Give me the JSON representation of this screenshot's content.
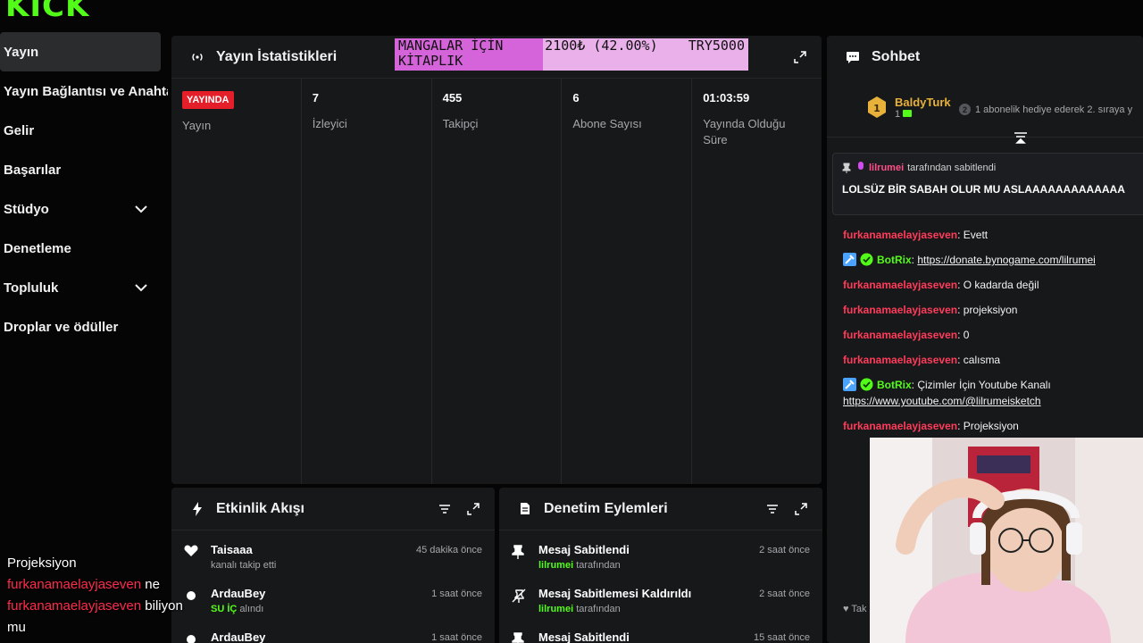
{
  "brand": {
    "logo_text": "KICK",
    "accent": "#53fc18"
  },
  "sidebar": {
    "items": [
      {
        "label": "Yayın",
        "active": true
      },
      {
        "label": "Yayın Bağlantısı ve Anahtarı"
      },
      {
        "label": "Gelir"
      },
      {
        "label": "Başarılar"
      },
      {
        "label": "Stüdyo",
        "expandable": true
      },
      {
        "label": "Denetleme"
      },
      {
        "label": "Topluluk",
        "expandable": true
      },
      {
        "label": "Droplar ve ödüller"
      }
    ]
  },
  "stats": {
    "title": "Yayın İstatistikleri",
    "goal": {
      "label": "MANGALAR İÇİN KİTAPLIK",
      "current": "2100₺ (42.00%)",
      "target": "TRY5000",
      "progress_percent": 42
    },
    "columns": [
      {
        "value": "YAYINDA",
        "label": "Yayın",
        "is_badge": true
      },
      {
        "value": "7",
        "label": "İzleyici"
      },
      {
        "value": "455",
        "label": "Takipçi"
      },
      {
        "value": "6",
        "label": "Abone Sayısı"
      },
      {
        "value": "01:03:59",
        "label": "Yayında Olduğu Süre"
      }
    ]
  },
  "activity": {
    "title": "Etkinlik Akışı",
    "rows": [
      {
        "name": "Taisaaa",
        "sub_prefix": "",
        "sub": "kanalı takip etti",
        "time": "45 dakika önce"
      },
      {
        "name": "ArdauBey",
        "sub_prefix": "SU İÇ",
        "sub": "alındı",
        "time": "1 saat önce"
      },
      {
        "name": "ArdauBey",
        "sub_prefix": "",
        "sub": "",
        "time": "1 saat önce"
      }
    ]
  },
  "modlog": {
    "title": "Denetim Eylemleri",
    "rows": [
      {
        "name": "Mesaj Sabitlendi",
        "by": "lilrumei",
        "sub": "tarafından",
        "time": "2 saat önce"
      },
      {
        "name": "Mesaj Sabitlemesi Kaldırıldı",
        "by": "lilrumei",
        "sub": "tarafından",
        "time": "2 saat önce"
      },
      {
        "name": "Mesaj Sabitlendi",
        "by": "",
        "sub": "",
        "time": "15 saat önce"
      }
    ]
  },
  "chat": {
    "title": "Sohbet",
    "leader": {
      "name": "BaldyTurk",
      "rank": "1",
      "sub_count": "1",
      "gift_text": "1 abonelik hediye ederek 2. sıraya y"
    },
    "pinned": {
      "user": "lilrumei",
      "suffix": "tarafından sabitlendi",
      "message": "LOLSÜZ BİR SABAH OLUR MU ASLAAAAAAAAAAAAA"
    },
    "messages": [
      {
        "user": "furkanamaelayjaseven",
        "text": "Evett"
      },
      {
        "bot": "BotRix",
        "text": "https://donate.bynogame.com/lilrumei",
        "link": true
      },
      {
        "user": "furkanamaelayjaseven",
        "text": "O kadarda değil"
      },
      {
        "user": "furkanamaelayjaseven",
        "text": "projeksiyon"
      },
      {
        "user": "furkanamaelayjaseven",
        "text": "0"
      },
      {
        "user": "furkanamaelayjaseven",
        "text": "calısma"
      },
      {
        "bot": "BotRix",
        "text": "Çizimler İçin Youtube Kanalı",
        "link2": "https://www.youtube.com/@lilrumeisketch"
      },
      {
        "user": "furkanamaelayjaseven",
        "text": "Projeksiyon"
      }
    ],
    "footer_partial": "Tak"
  },
  "overlay_chat": {
    "line1": "Projeksiyon",
    "user": "furkanamaelayjaseven",
    "text1": "ne",
    "text2": "biliyon",
    "text3": "mu"
  }
}
